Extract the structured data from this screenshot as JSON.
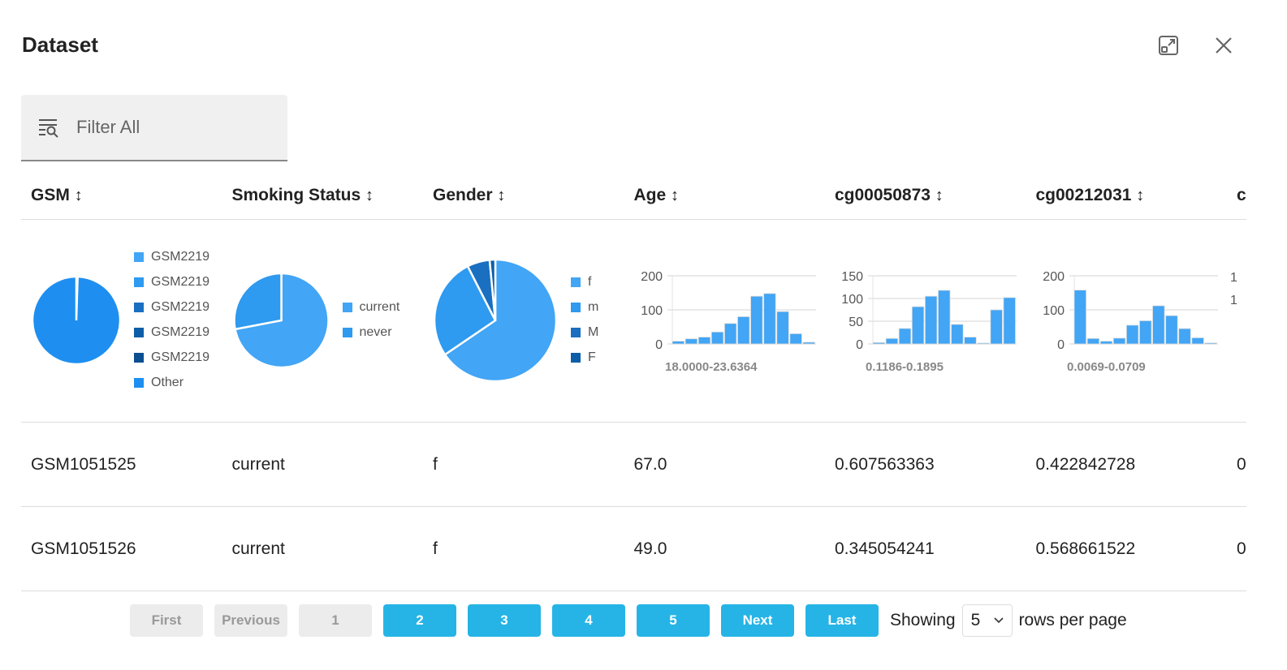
{
  "header": {
    "title": "Dataset",
    "expand_icon": "expand-icon",
    "close_icon": "close-icon"
  },
  "filter": {
    "placeholder": "Filter All",
    "icon": "filter-search-icon"
  },
  "columns": [
    {
      "label": "GSM",
      "sort": "↕"
    },
    {
      "label": "Smoking Status",
      "sort": "↕"
    },
    {
      "label": "Gender",
      "sort": "↕"
    },
    {
      "label": "Age",
      "sort": "↕"
    },
    {
      "label": "cg00050873",
      "sort": "↕"
    },
    {
      "label": "cg00212031",
      "sort": "↕"
    },
    {
      "label": "c",
      "sort": ""
    }
  ],
  "rows": [
    [
      "GSM1051525",
      "current",
      "f",
      "67.0",
      "0.607563363",
      "0.422842728",
      "0"
    ],
    [
      "GSM1051526",
      "current",
      "f",
      "49.0",
      "0.345054241",
      "0.568661522",
      "0"
    ]
  ],
  "chart_data": [
    {
      "type": "pie",
      "column": "GSM",
      "labels": [
        "GSM2219",
        "GSM2219",
        "GSM2219",
        "GSM2219",
        "GSM2219",
        "Other"
      ],
      "values": [
        0.001,
        0.001,
        0.001,
        0.001,
        0.001,
        0.995
      ],
      "colors": [
        "#42a5f5",
        "#2e9af0",
        "#1a6fc0",
        "#0d5ea8",
        "#0b4f91",
        "#1e8ff0"
      ],
      "legend": "right"
    },
    {
      "type": "pie",
      "column": "Smoking Status",
      "labels": [
        "current",
        "never"
      ],
      "values": [
        0.72,
        0.28
      ],
      "colors": [
        "#42a5f5",
        "#2e9af0"
      ],
      "legend": "right"
    },
    {
      "type": "pie",
      "column": "Gender",
      "labels": [
        "f",
        "m",
        "M",
        "F"
      ],
      "values": [
        0.655,
        0.27,
        0.06,
        0.015
      ],
      "colors": [
        "#42a5f5",
        "#2e9af0",
        "#1a6fc0",
        "#0d5ea8"
      ],
      "legend": "right"
    },
    {
      "type": "bar",
      "column": "Age",
      "values": [
        8,
        15,
        20,
        35,
        60,
        80,
        140,
        148,
        95,
        30,
        5
      ],
      "ylim": [
        0,
        200
      ],
      "yticks": [
        "0",
        "100",
        "200"
      ],
      "xlabel": "18.0000-23.6364",
      "color": "#42a5f5",
      "grid": true
    },
    {
      "type": "bar",
      "column": "cg00050873",
      "values": [
        3,
        12,
        34,
        82,
        105,
        118,
        43,
        15,
        2,
        75,
        102
      ],
      "ylim": [
        0,
        150
      ],
      "yticks": [
        "0",
        "50",
        "100",
        "150"
      ],
      "xlabel": "0.1186-0.1895",
      "color": "#42a5f5",
      "grid": true
    },
    {
      "type": "bar",
      "column": "cg00212031",
      "values": [
        158,
        16,
        8,
        17,
        55,
        68,
        112,
        83,
        45,
        18,
        3
      ],
      "ylim": [
        0,
        200
      ],
      "yticks": [
        "0",
        "100",
        "200"
      ],
      "xlabel": "0.0069-0.0709",
      "color": "#42a5f5",
      "grid": true
    }
  ],
  "partial_chart": {
    "yticks": [
      "1",
      "1"
    ]
  },
  "pagination": {
    "first": "First",
    "previous": "Previous",
    "pages": [
      "1",
      "2",
      "3",
      "4",
      "5"
    ],
    "current_page": "1",
    "next": "Next",
    "last": "Last",
    "showing": "Showing",
    "rows_per_page_value": "5",
    "rows_per_page": "rows per page",
    "colors": {
      "active": "#26b4e6",
      "disabled": "#ececec"
    }
  }
}
